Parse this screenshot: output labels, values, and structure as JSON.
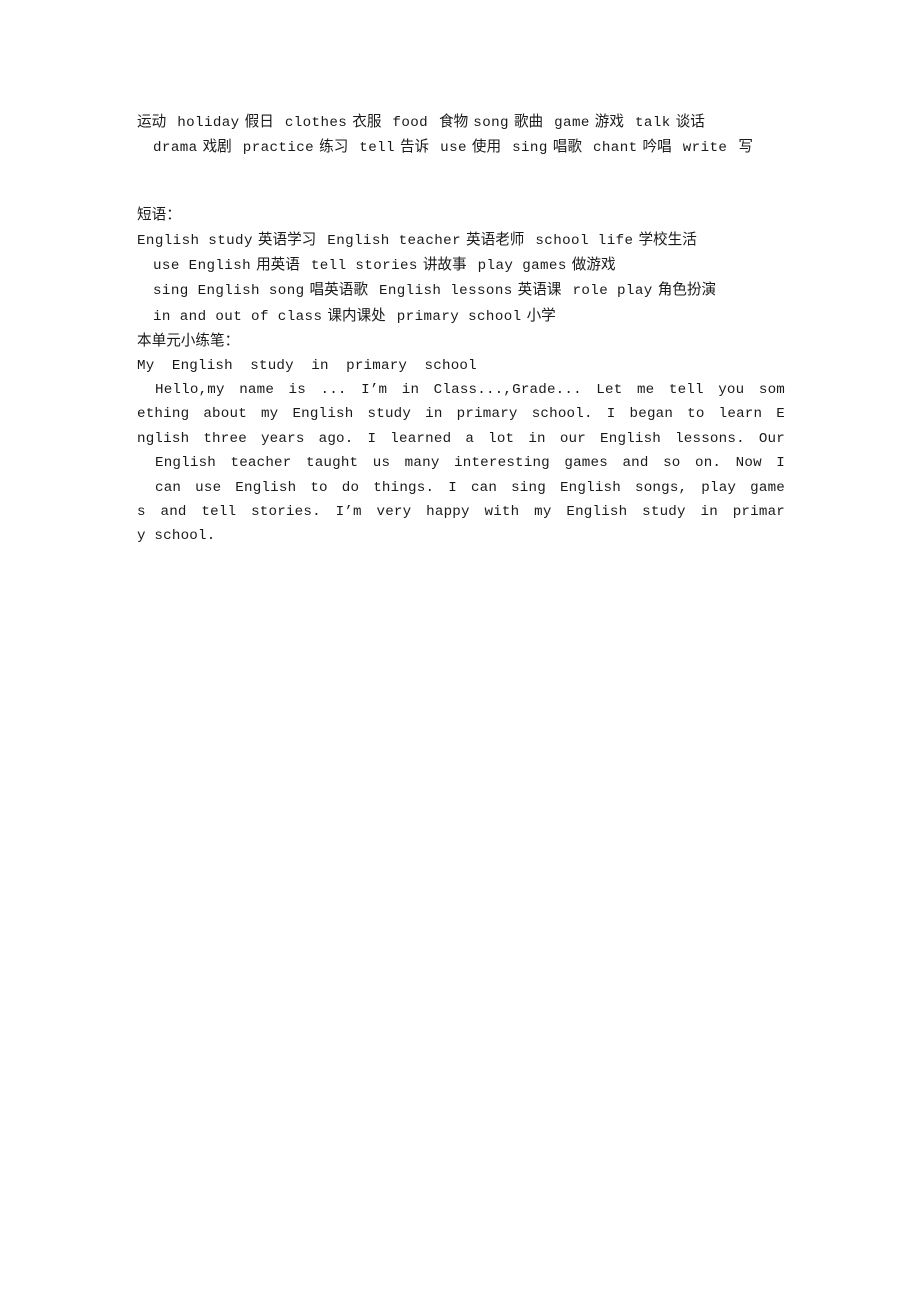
{
  "document": {
    "page_background": "#ffffff",
    "text_color": "#1a1a1a",
    "vocabulary_lines": [
      {
        "id": "vocab-line-1",
        "indent": false,
        "tokens": [
          {
            "en": "",
            "cn": "运动"
          },
          {
            "en": "holiday",
            "cn": "假日"
          },
          {
            "en": "clothes",
            "cn": "衣服"
          },
          {
            "en": "food",
            "cn": ""
          },
          {
            "en": "",
            "cn": "食物"
          },
          {
            "en": "song",
            "cn": "歌曲"
          },
          {
            "en": "game",
            "cn": "游戏"
          },
          {
            "en": "talk",
            "cn": "谈话"
          }
        ],
        "plain": "运动  holiday 假日  clothes 衣服  food  食物 song 歌曲  game 游戏  talk 谈话"
      },
      {
        "id": "vocab-line-2",
        "indent": true,
        "tokens": [
          {
            "en": "drama",
            "cn": "戏剧"
          },
          {
            "en": "practice",
            "cn": "练习"
          },
          {
            "en": "tell",
            "cn": "告诉"
          },
          {
            "en": "use",
            "cn": "使用"
          },
          {
            "en": "sing",
            "cn": "唱歌"
          },
          {
            "en": "chant",
            "cn": "吟唱"
          },
          {
            "en": "write",
            "cn": "写"
          }
        ],
        "plain": "drama 戏剧  practice 练习  tell 告诉  use 使用  sing 唱歌  chant 吟唱  write  写"
      }
    ],
    "phrases_heading": "短语：",
    "phrase_lines": [
      {
        "id": "phrase-line-1",
        "indent": false,
        "tokens": [
          {
            "en": "English  study",
            "cn": "英语学习"
          },
          {
            "en": "English   teacher",
            "cn": "英语老师"
          },
          {
            "en": "school   life",
            "cn": "学校生活"
          }
        ],
        "plain": "English  study 英语学习  English   teacher 英语老师   school   life 学校生活"
      },
      {
        "id": "phrase-line-2",
        "indent": true,
        "tokens": [
          {
            "en": "use   English",
            "cn": "用英语"
          },
          {
            "en": "tell   stories",
            "cn": "讲故事"
          },
          {
            "en": "play   games",
            "cn": "做游戏"
          }
        ],
        "plain": "use   English 用英语   tell   stories 讲故事   play   games 做游戏"
      },
      {
        "id": "phrase-line-3",
        "indent": true,
        "tokens": [
          {
            "en": "sing   English   song",
            "cn": "唱英语歌"
          },
          {
            "en": "English   lessons",
            "cn": "英语课"
          },
          {
            "en": "role   play",
            "cn": "角色扮演"
          }
        ],
        "plain": "sing   English   song 唱英语歌   English   lessons 英语课   role   play 角色扮演"
      },
      {
        "id": "phrase-line-4",
        "indent": true,
        "tokens": [
          {
            "en": "in  and  out  of  class",
            "cn": "课内课处"
          },
          {
            "en": "primary   school",
            "cn": "小学"
          }
        ],
        "plain": "in  and  out  of  class 课内课处   primary   school 小学"
      }
    ],
    "writing_heading": "本单元小练笔：",
    "composition_title": "My  English  study  in  primary  school",
    "composition_lines": [
      {
        "id": "comp-line-1",
        "indent": true,
        "justify": true,
        "text": "Hello,my  name  is  ...  I’m  in  Class...,Grade...  Let  me  tell  you  som"
      },
      {
        "id": "comp-line-2",
        "indent": false,
        "justify": true,
        "text": "ething  about  my  English  study  in  primary  school.  I  began  to  learn  E"
      },
      {
        "id": "comp-line-3",
        "indent": false,
        "justify": true,
        "text": "nglish  three  years  ago.  I  learned  a  lot  in  our  English  lessons.  Our"
      },
      {
        "id": "comp-line-4",
        "indent": true,
        "justify": true,
        "text": "English  teacher  taught  us  many  interesting  games  and  so  on.  Now  I"
      },
      {
        "id": "comp-line-5",
        "indent": true,
        "justify": true,
        "text": "can  use  English  to  do  things.  I  can  sing  English  songs,  play  game"
      },
      {
        "id": "comp-line-6",
        "indent": false,
        "justify": true,
        "text": "s  and  tell  stories.  I’m  very  happy  with  my  English  study  in  primar"
      },
      {
        "id": "comp-line-7",
        "indent": false,
        "justify": false,
        "text": "y  school."
      }
    ]
  }
}
